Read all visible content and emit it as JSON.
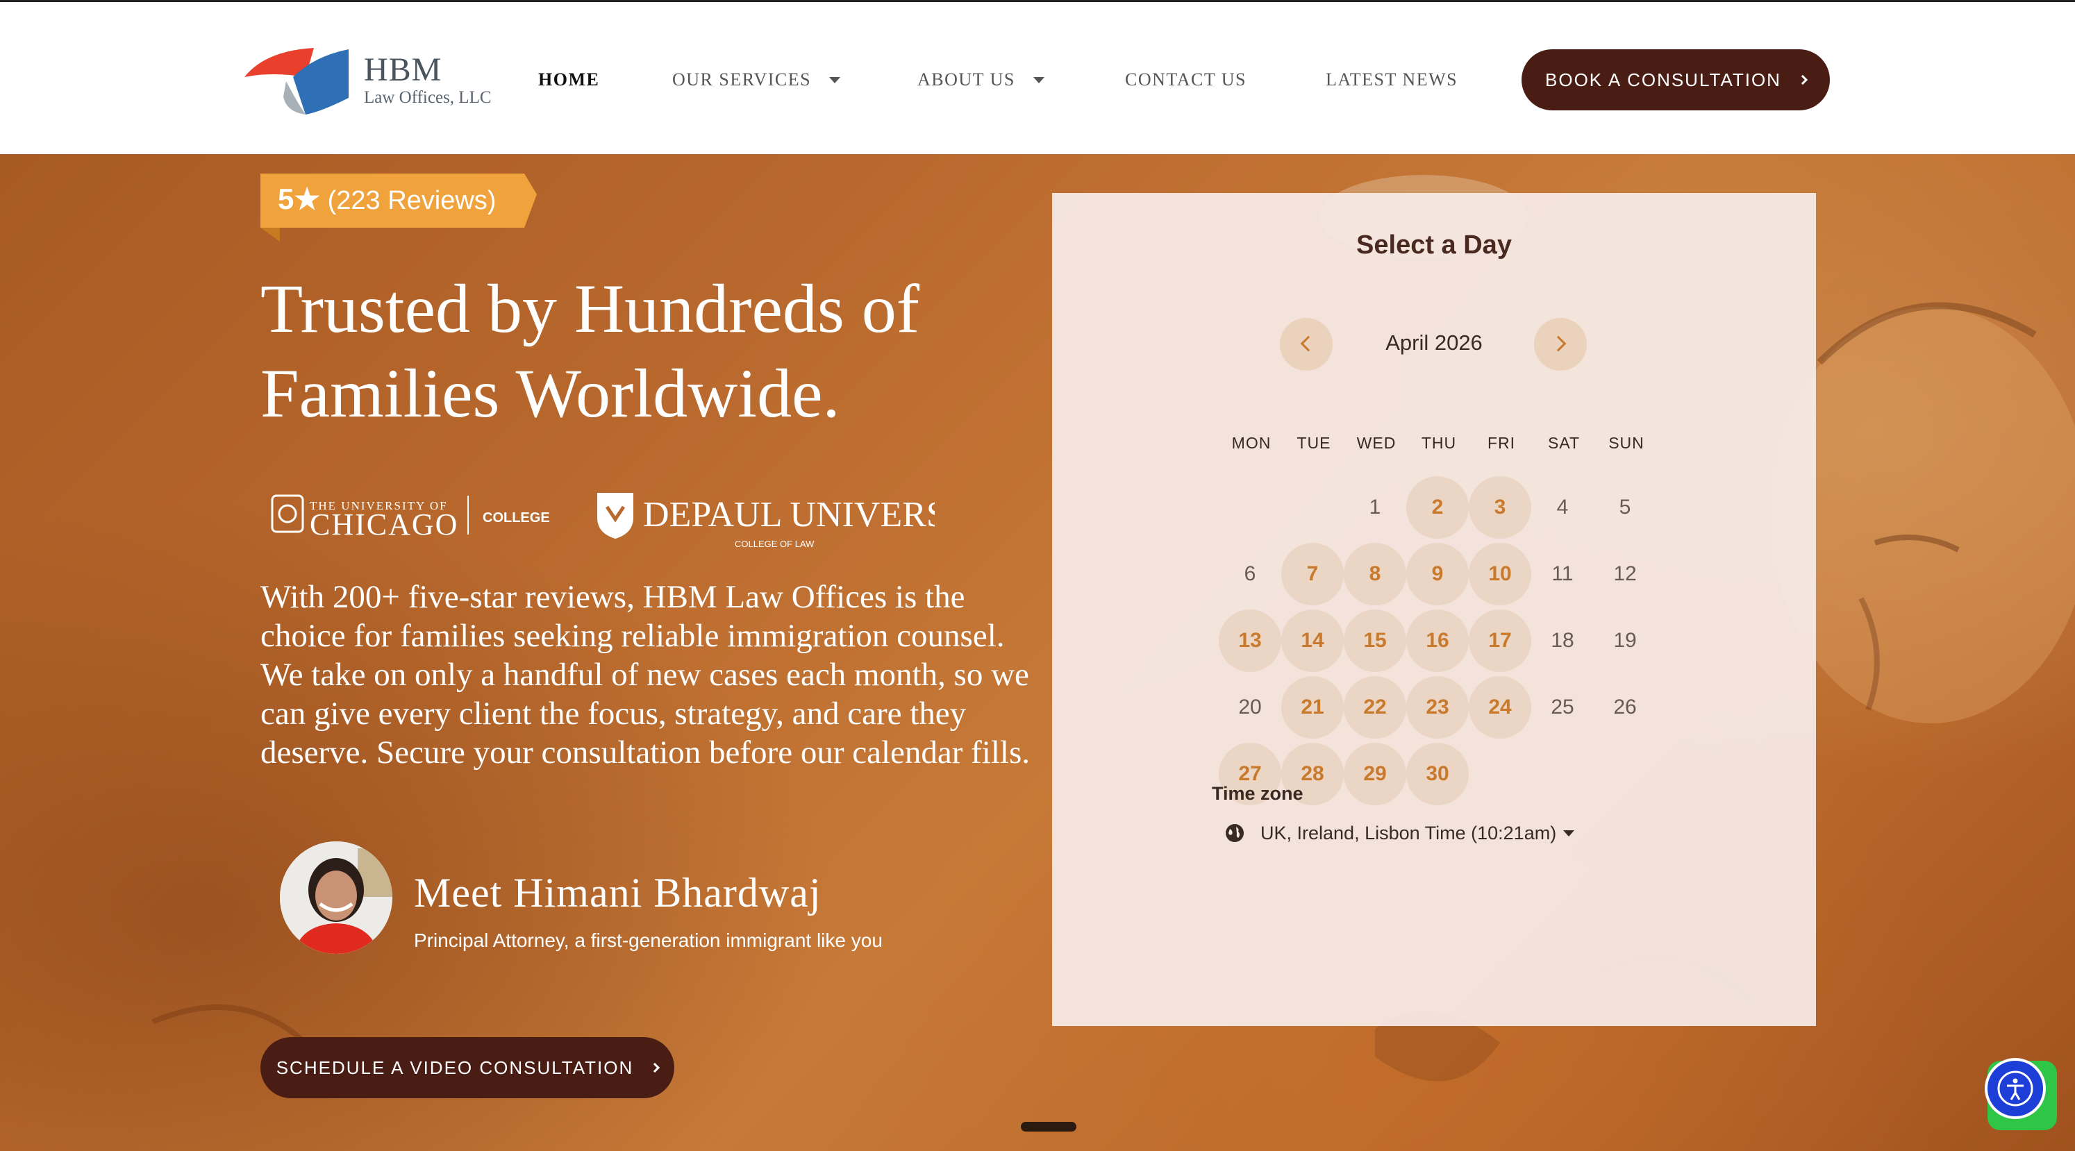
{
  "header": {
    "logo": {
      "title": "HBM",
      "subtitle": "Law Offices, LLC"
    },
    "nav": [
      {
        "label": "HOME",
        "active": true,
        "dropdown": false
      },
      {
        "label": "OUR SERVICES",
        "active": false,
        "dropdown": true
      },
      {
        "label": "ABOUT US",
        "active": false,
        "dropdown": true
      },
      {
        "label": "CONTACT US",
        "active": false,
        "dropdown": false
      },
      {
        "label": "LATEST NEWS",
        "active": false,
        "dropdown": false
      }
    ],
    "cta_label": "BOOK A CONSULTATION"
  },
  "hero": {
    "rating": {
      "stars": "5★",
      "reviews": "(223 Reviews)"
    },
    "title": "Trusted by Hundreds of Families Worldwide.",
    "logos": {
      "uchicago_small": "THE UNIVERSITY OF",
      "uchicago_big": "CHICAGO",
      "uchicago_college": "COLLEGE",
      "depaul": "DEPAUL UNIVERSITY",
      "depaul_sub": "COLLEGE OF LAW"
    },
    "paragraph": "With 200+ five-star reviews, HBM Law Offices is the choice for families seeking reliable immigration counsel. We take on only a handful of new cases each month, so we can give every client the focus, strategy, and care they deserve. Secure your consultation before our calendar fills.",
    "attorney": {
      "name": "Meet Himani Bhardwaj",
      "title": "Principal Attorney, a first-generation immigrant like you"
    },
    "video_cta_label": "SCHEDULE A VIDEO CONSULTATION"
  },
  "calendar": {
    "title": "Select a Day",
    "month": "April 2026",
    "weekdays": [
      "MON",
      "TUE",
      "WED",
      "THU",
      "FRI",
      "SAT",
      "SUN"
    ],
    "first_weekday_index": 2,
    "days_in_month": 30,
    "available_days": [
      2,
      3,
      7,
      8,
      9,
      10,
      13,
      14,
      15,
      16,
      17,
      21,
      22,
      23,
      24,
      27,
      28,
      29,
      30
    ],
    "timezone_label": "Time zone",
    "timezone_value": "UK, Ireland, Lisbon Time (10:21am)"
  },
  "colors": {
    "brand_dark": "#4a1d14",
    "accent_orange": "#c97a2c",
    "ribbon": "#f0a23c",
    "hero_bg": "#b9692d"
  },
  "icons": [
    "hbm-logo-icon",
    "caret-down-icon",
    "chevron-right-icon",
    "chevron-left-icon",
    "globe-icon",
    "accessibility-icon",
    "whatsapp-icon"
  ]
}
